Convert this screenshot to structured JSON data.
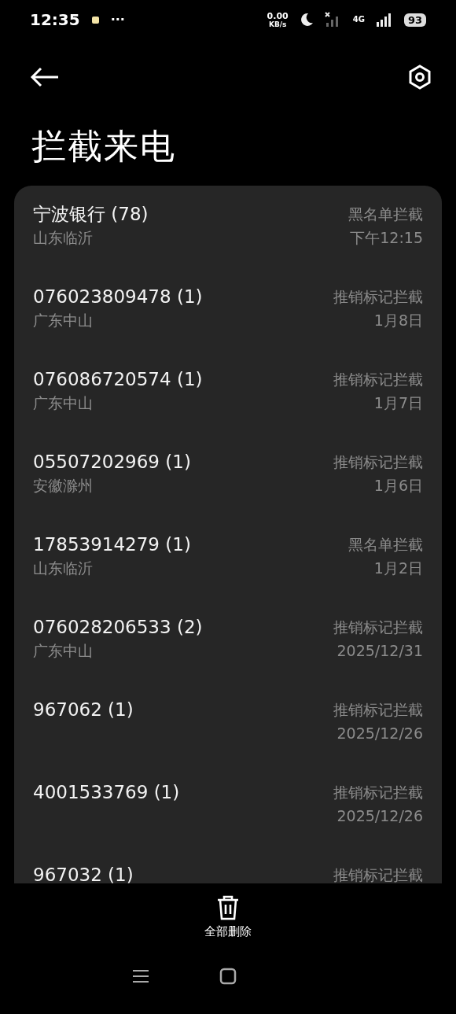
{
  "status_bar": {
    "time": "12:35",
    "more": "···",
    "net_speed": "0.00",
    "net_unit": "KB/s",
    "network": "4G",
    "battery": "93"
  },
  "title": "拦截来电",
  "calls": [
    {
      "name": "宁波银行 (78)",
      "location": "山东临沂",
      "reason": "黑名单拦截",
      "time": "下午12:15"
    },
    {
      "name": "076023809478 (1)",
      "location": "广东中山",
      "reason": "推销标记拦截",
      "time": "1月8日"
    },
    {
      "name": "076086720574 (1)",
      "location": "广东中山",
      "reason": "推销标记拦截",
      "time": "1月7日"
    },
    {
      "name": "05507202969 (1)",
      "location": "安徽滁州",
      "reason": "推销标记拦截",
      "time": "1月6日"
    },
    {
      "name": "17853914279 (1)",
      "location": "山东临沂",
      "reason": "黑名单拦截",
      "time": "1月2日"
    },
    {
      "name": "076028206533 (2)",
      "location": "广东中山",
      "reason": "推销标记拦截",
      "time": "2025/12/31"
    },
    {
      "name": "967062 (1)",
      "reason": "推销标记拦截",
      "time": "2025/12/26"
    },
    {
      "name": "4001533769 (1)",
      "reason": "推销标记拦截",
      "time": "2025/12/26"
    },
    {
      "name": "967032 (1)",
      "reason": "推销标记拦截"
    }
  ],
  "delete_all": "全部删除"
}
